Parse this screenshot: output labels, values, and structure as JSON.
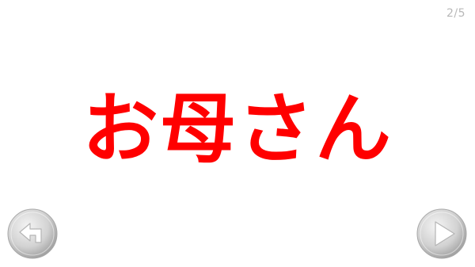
{
  "page_counter": "2/5",
  "card": {
    "word": "お母さん",
    "word_color": "#ff0000"
  },
  "navigation": {
    "back_icon": "back-arrow-icon",
    "next_icon": "play-triangle-icon",
    "button_color": "#c8c8c8"
  }
}
